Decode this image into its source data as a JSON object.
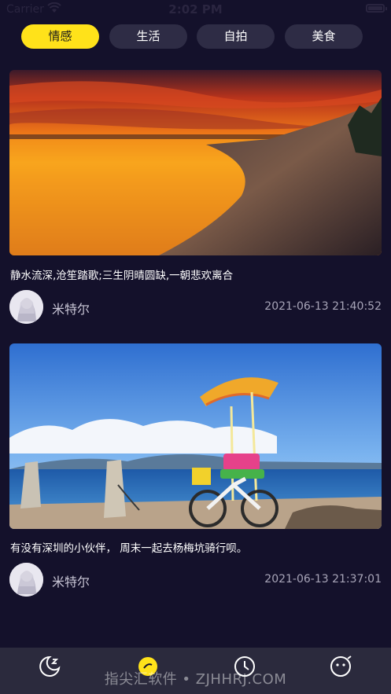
{
  "status_bar": {
    "carrier": "Carrier",
    "time": "2:02 PM"
  },
  "tabs": [
    {
      "label": "情感",
      "active": true
    },
    {
      "label": "生活",
      "active": false
    },
    {
      "label": "自拍",
      "active": false
    },
    {
      "label": "美食",
      "active": false
    }
  ],
  "posts": [
    {
      "image": "sunset-coast-photo",
      "caption": "静水流深,沧笙踏歌;三生阴晴圆缺,一朝悲欢离合",
      "author": "米特尔",
      "timestamp": "2021-06-13 21:40:52"
    },
    {
      "image": "seaside-bicycle-photo",
      "caption": "有没有深圳的小伙伴， 周末一起去杨梅坑骑行呗。",
      "author": "米特尔",
      "timestamp": "2021-06-13 21:37:01"
    }
  ],
  "tab_bar": {
    "items": [
      {
        "icon": "moon-sleep-icon"
      },
      {
        "icon": "eye-circle-icon",
        "active": true
      },
      {
        "icon": "clock-icon"
      },
      {
        "icon": "smile-face-icon"
      }
    ],
    "active_color": "#ffe21a",
    "inactive_color": "#ffffff"
  },
  "watermark": "指尖汇软件 • ZJHHRJ.COM",
  "colors": {
    "background": "#14112b",
    "accent": "#ffe21a",
    "tab_bg": "#2e2c45"
  }
}
